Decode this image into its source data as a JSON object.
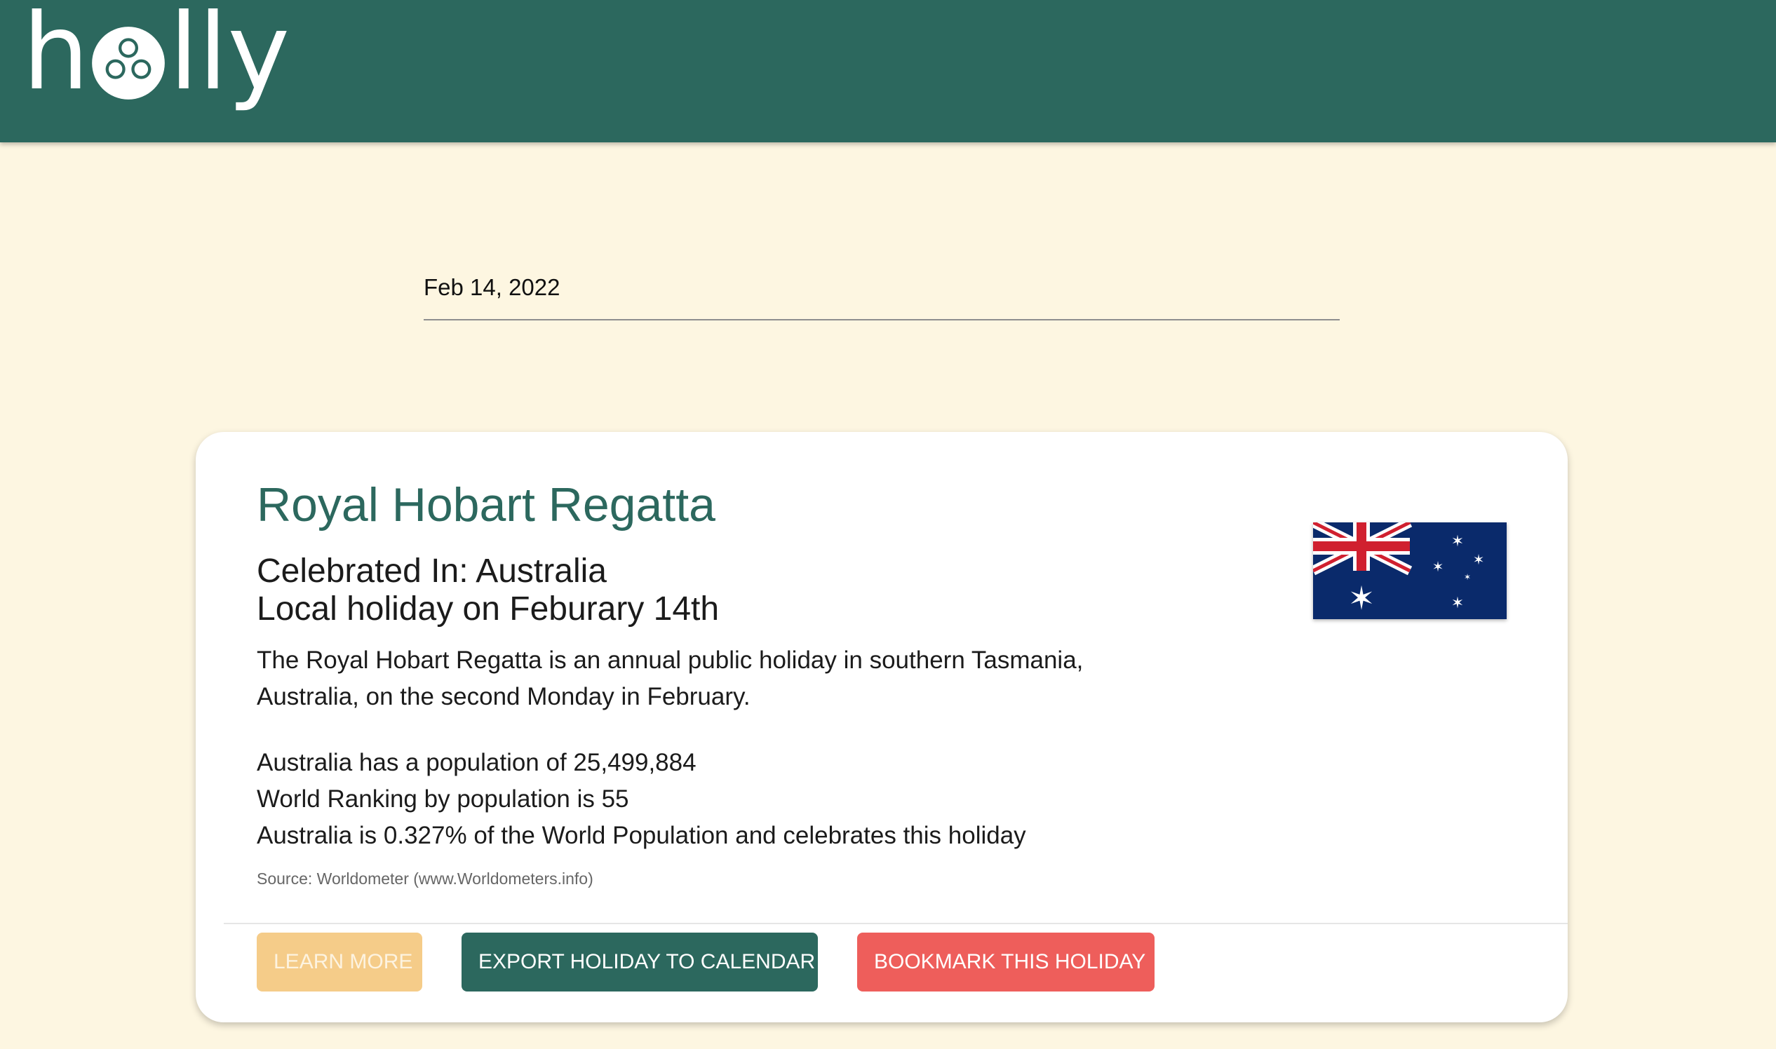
{
  "app": {
    "logo_text": "holly",
    "brand_color": "#2c685e"
  },
  "date_picker": {
    "value": "Feb 14, 2022"
  },
  "holiday": {
    "title": "Royal Hobart Regatta",
    "celebrated_in": "Celebrated In: Australia",
    "local_holiday": "Local holiday on Feburary 14th",
    "description": "The Royal Hobart Regatta is an annual public holiday in southern Tasmania, Australia, on the second Monday in February.",
    "population": "Australia has a population of 25,499,884",
    "ranking": "World Ranking by population is 55",
    "share": "Australia is 0.327% of the World Population and celebrates this holiday",
    "source": "Source: Worldometer (www.Worldometers.info)",
    "flag_icon": "australia-flag-icon"
  },
  "actions": {
    "learn_more": "LEARN MORE",
    "export": "EXPORT HOLIDAY TO CALENDAR",
    "bookmark": "BOOKMARK THIS HOLIDAY"
  }
}
